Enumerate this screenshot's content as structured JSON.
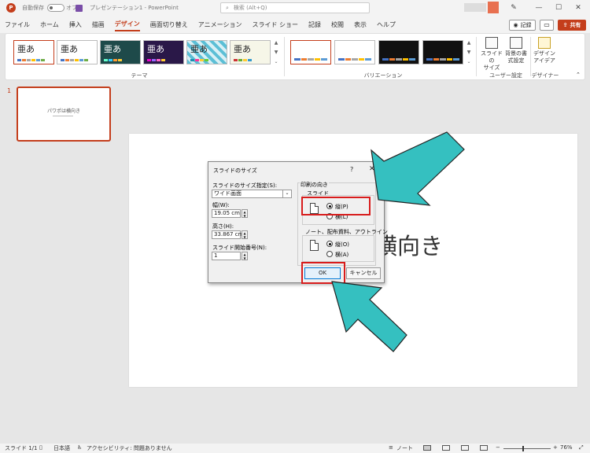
{
  "titlebar": {
    "autosave_label": "自動保存",
    "autosave_state": "オフ",
    "document_title": "プレゼンテーション1 - PowerPoint",
    "search_placeholder": "検索 (Alt+Q)",
    "minimize": "—",
    "maximize": "☐",
    "close": "✕"
  },
  "tabs": [
    "ファイル",
    "ホーム",
    "挿入",
    "描画",
    "デザイン",
    "画面切り替え",
    "アニメーション",
    "スライド ショー",
    "記録",
    "校閲",
    "表示",
    "ヘルプ"
  ],
  "active_tab": "デザイン",
  "actions": {
    "record_label": "記録",
    "share_label": "共有"
  },
  "ribbon": {
    "theme_glyph": "亜あ",
    "theme_group_label": "テーマ",
    "variation_group_label": "バリエーション",
    "user_settings_group_label": "ユーザー設定",
    "designer_group_label": "デザイナー",
    "slide_size_label_1": "スライドの",
    "slide_size_label_2": "サイズ",
    "format_bg_label_1": "背景の書",
    "format_bg_label_2": "式設定",
    "design_ideas_label_1": "デザイン",
    "design_ideas_label_2": "アイデア"
  },
  "thumbnail": {
    "number": "1",
    "title": "パワポは横向き"
  },
  "slide": {
    "visible_text": "横向き"
  },
  "dialog": {
    "title": "スライドのサイズ",
    "help": "?",
    "close": "✕",
    "size_label": "スライドのサイズ指定(S):",
    "size_value": "ワイド画面",
    "width_label": "幅(W):",
    "width_value": "19.05 cm",
    "height_label": "高さ(H):",
    "height_value": "33.867 cm",
    "start_label": "スライド開始番号(N):",
    "start_value": "1",
    "orientation_label": "印刷の向き",
    "slides_label": "スライド",
    "slides_portrait": "縦(P)",
    "slides_landscape": "横(L)",
    "notes_label": "ノート、配布資料、アウトライン",
    "notes_portrait": "縦(O)",
    "notes_landscape": "横(A)",
    "ok": "OK",
    "cancel": "キャンセル"
  },
  "statusbar": {
    "slide_count": "スライド 1/1",
    "language": "日本語",
    "accessibility": "アクセシビリティ: 問題ありません",
    "notes": "ノート",
    "zoom_minus": "−",
    "zoom_plus": "+",
    "zoom": "76%"
  },
  "colors": {
    "accent": "#c43e1c",
    "highlight": "#d81c1c",
    "arrow": "#35c0c0",
    "ok_border": "#0078d7"
  }
}
